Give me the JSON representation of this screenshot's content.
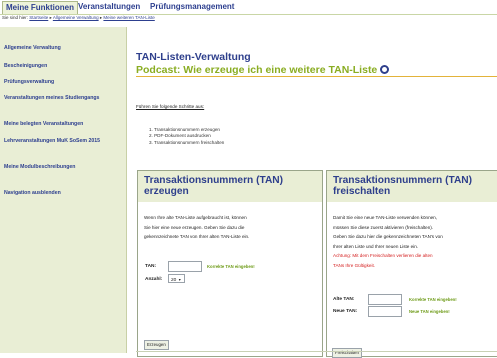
{
  "topnav": {
    "tabs": [
      "Meine Funktionen",
      "Veranstaltungen",
      "Prüfungsmanagement"
    ]
  },
  "breadcrumb": {
    "prefix": "Sie sind hier:",
    "items": [
      "Startseite",
      "Allgemeine Verwaltung",
      "Meine weiteren TAN-Liste"
    ]
  },
  "sidebar": {
    "items": [
      "Allgemeine Verwaltung",
      "Bescheinigungen",
      "Prüfungsverwaltung",
      "Veranstaltungen meines Studiengangs",
      "Meine belegten Veranstaltungen",
      "Lehrveranstaltungen MuK SoSem 2015",
      "Meine Modulbeschreibungen",
      "Navigation ausblenden"
    ]
  },
  "main": {
    "title": "TAN-Listen-Verwaltung",
    "subtitle": "Podcast: Wie erzeuge ich eine weitere TAN-Liste",
    "intro": "Führen Sie folgende Schritte aus:",
    "steps": [
      "1. Transaktionsnummern erzeugen",
      "2. PDF-Dokument ausdrucken",
      "3. Transaktionsnummern freischalten"
    ]
  },
  "box_left": {
    "title": "Transaktionsnummern (TAN) erzeugen",
    "lines": [
      "Wenn Ihre alte TAN-Liste aufgebraucht ist, können",
      "Sie hier eine neue erzeugen. Geben Sie dazu die",
      "gekennzeichnete TAN von Ihrer alten TAN-Liste ein."
    ],
    "tan_label": "TAN:",
    "tan_value": "",
    "tan_hint": "Korrekte TAN eingeben!",
    "count_label": "Anzahl:",
    "count_value": "20",
    "button": "Erzeugen"
  },
  "box_right": {
    "title": "Transaktionsnummern (TAN) freischalten",
    "lines": [
      "Damit Sie eine neue TAN-Liste verwenden können,",
      "müssen Sie diese zuerst aktivieren (freischalten).",
      "Geben Sie dazu hier die gekennzeichneten TAN's von",
      "Ihrer alten Liste und Ihrer neuen Liste ein."
    ],
    "warning": [
      "Achtung: Mit dem Freischalten verlieren die alten",
      "TANs Ihre Gültigkeit."
    ],
    "old_label": "Alte TAN:",
    "old_hint": "Korrekte TAN eingeben!",
    "new_label": "Neue TAN:",
    "new_hint": "Neue TAN eingeben!",
    "button": "Freischalten"
  },
  "colors": {
    "nav_blue": "#2d3f8f",
    "title_blue": "#2e3f8c",
    "podcast_green": "#8aad22",
    "sidebar_bg": "#e9eed5",
    "warning_red": "#d41d1d",
    "hint_green": "#6e9b18"
  },
  "icons": [
    "podcast-play-icon",
    "breadcrumb-arrow-icon",
    "select-arrow-icon"
  ]
}
